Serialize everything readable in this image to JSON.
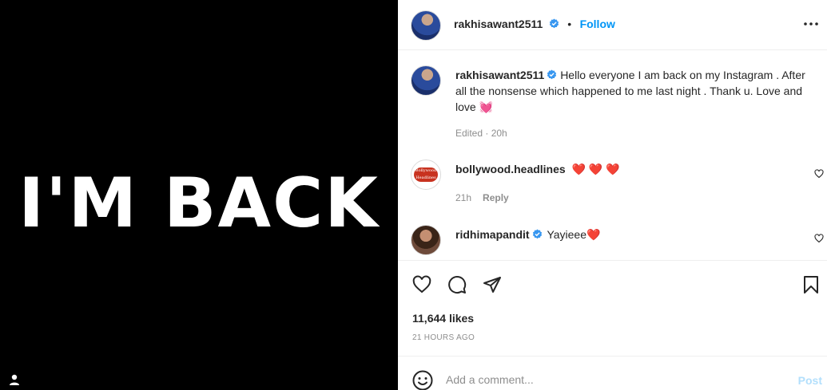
{
  "media": {
    "text": "I'M  BACK"
  },
  "header": {
    "username": "rakhisawant2511",
    "separator": "•",
    "follow_label": "Follow"
  },
  "caption": {
    "username": "rakhisawant2511",
    "text": "Hello everyone I am back on my Instagram . After all the nonsense which happened to me last night . Thank u. Love and love 💓",
    "edited": "Edited · 20h"
  },
  "comments": [
    {
      "username": "bollywood.headlines",
      "text": "❤️ ❤️ ❤️",
      "time": "21h",
      "reply_label": "Reply",
      "avatar_text": "Bollywood Headlines"
    },
    {
      "username": "ridhimapandit",
      "text": "Yayieee❤️"
    }
  ],
  "post": {
    "likes": "11,644 likes",
    "time_ago": "21 HOURS AGO"
  },
  "composer": {
    "placeholder": "Add a comment...",
    "post_label": "Post"
  },
  "colors": {
    "accent": "#0095f6",
    "verified": "#3897f0",
    "heart": "#ed4956"
  }
}
